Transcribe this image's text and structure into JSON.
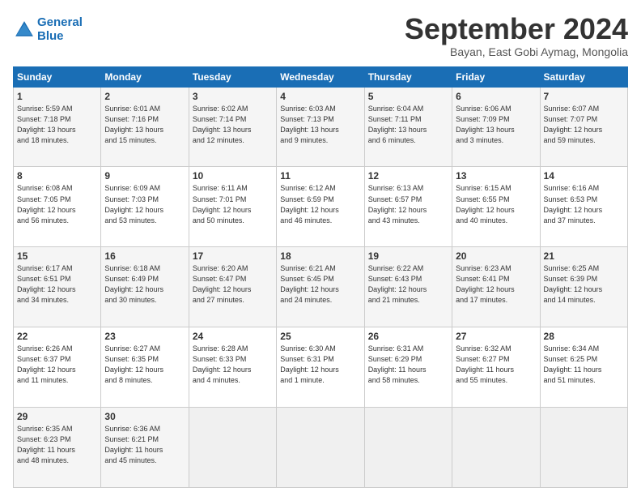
{
  "header": {
    "logo_line1": "General",
    "logo_line2": "Blue",
    "month_title": "September 2024",
    "subtitle": "Bayan, East Gobi Aymag, Mongolia"
  },
  "weekdays": [
    "Sunday",
    "Monday",
    "Tuesday",
    "Wednesday",
    "Thursday",
    "Friday",
    "Saturday"
  ],
  "weeks": [
    [
      {
        "day": "1",
        "info": "Sunrise: 5:59 AM\nSunset: 7:18 PM\nDaylight: 13 hours\nand 18 minutes."
      },
      {
        "day": "2",
        "info": "Sunrise: 6:01 AM\nSunset: 7:16 PM\nDaylight: 13 hours\nand 15 minutes."
      },
      {
        "day": "3",
        "info": "Sunrise: 6:02 AM\nSunset: 7:14 PM\nDaylight: 13 hours\nand 12 minutes."
      },
      {
        "day": "4",
        "info": "Sunrise: 6:03 AM\nSunset: 7:13 PM\nDaylight: 13 hours\nand 9 minutes."
      },
      {
        "day": "5",
        "info": "Sunrise: 6:04 AM\nSunset: 7:11 PM\nDaylight: 13 hours\nand 6 minutes."
      },
      {
        "day": "6",
        "info": "Sunrise: 6:06 AM\nSunset: 7:09 PM\nDaylight: 13 hours\nand 3 minutes."
      },
      {
        "day": "7",
        "info": "Sunrise: 6:07 AM\nSunset: 7:07 PM\nDaylight: 12 hours\nand 59 minutes."
      }
    ],
    [
      {
        "day": "8",
        "info": "Sunrise: 6:08 AM\nSunset: 7:05 PM\nDaylight: 12 hours\nand 56 minutes."
      },
      {
        "day": "9",
        "info": "Sunrise: 6:09 AM\nSunset: 7:03 PM\nDaylight: 12 hours\nand 53 minutes."
      },
      {
        "day": "10",
        "info": "Sunrise: 6:11 AM\nSunset: 7:01 PM\nDaylight: 12 hours\nand 50 minutes."
      },
      {
        "day": "11",
        "info": "Sunrise: 6:12 AM\nSunset: 6:59 PM\nDaylight: 12 hours\nand 46 minutes."
      },
      {
        "day": "12",
        "info": "Sunrise: 6:13 AM\nSunset: 6:57 PM\nDaylight: 12 hours\nand 43 minutes."
      },
      {
        "day": "13",
        "info": "Sunrise: 6:15 AM\nSunset: 6:55 PM\nDaylight: 12 hours\nand 40 minutes."
      },
      {
        "day": "14",
        "info": "Sunrise: 6:16 AM\nSunset: 6:53 PM\nDaylight: 12 hours\nand 37 minutes."
      }
    ],
    [
      {
        "day": "15",
        "info": "Sunrise: 6:17 AM\nSunset: 6:51 PM\nDaylight: 12 hours\nand 34 minutes."
      },
      {
        "day": "16",
        "info": "Sunrise: 6:18 AM\nSunset: 6:49 PM\nDaylight: 12 hours\nand 30 minutes."
      },
      {
        "day": "17",
        "info": "Sunrise: 6:20 AM\nSunset: 6:47 PM\nDaylight: 12 hours\nand 27 minutes."
      },
      {
        "day": "18",
        "info": "Sunrise: 6:21 AM\nSunset: 6:45 PM\nDaylight: 12 hours\nand 24 minutes."
      },
      {
        "day": "19",
        "info": "Sunrise: 6:22 AM\nSunset: 6:43 PM\nDaylight: 12 hours\nand 21 minutes."
      },
      {
        "day": "20",
        "info": "Sunrise: 6:23 AM\nSunset: 6:41 PM\nDaylight: 12 hours\nand 17 minutes."
      },
      {
        "day": "21",
        "info": "Sunrise: 6:25 AM\nSunset: 6:39 PM\nDaylight: 12 hours\nand 14 minutes."
      }
    ],
    [
      {
        "day": "22",
        "info": "Sunrise: 6:26 AM\nSunset: 6:37 PM\nDaylight: 12 hours\nand 11 minutes."
      },
      {
        "day": "23",
        "info": "Sunrise: 6:27 AM\nSunset: 6:35 PM\nDaylight: 12 hours\nand 8 minutes."
      },
      {
        "day": "24",
        "info": "Sunrise: 6:28 AM\nSunset: 6:33 PM\nDaylight: 12 hours\nand 4 minutes."
      },
      {
        "day": "25",
        "info": "Sunrise: 6:30 AM\nSunset: 6:31 PM\nDaylight: 12 hours\nand 1 minute."
      },
      {
        "day": "26",
        "info": "Sunrise: 6:31 AM\nSunset: 6:29 PM\nDaylight: 11 hours\nand 58 minutes."
      },
      {
        "day": "27",
        "info": "Sunrise: 6:32 AM\nSunset: 6:27 PM\nDaylight: 11 hours\nand 55 minutes."
      },
      {
        "day": "28",
        "info": "Sunrise: 6:34 AM\nSunset: 6:25 PM\nDaylight: 11 hours\nand 51 minutes."
      }
    ],
    [
      {
        "day": "29",
        "info": "Sunrise: 6:35 AM\nSunset: 6:23 PM\nDaylight: 11 hours\nand 48 minutes."
      },
      {
        "day": "30",
        "info": "Sunrise: 6:36 AM\nSunset: 6:21 PM\nDaylight: 11 hours\nand 45 minutes."
      },
      {
        "day": "",
        "info": ""
      },
      {
        "day": "",
        "info": ""
      },
      {
        "day": "",
        "info": ""
      },
      {
        "day": "",
        "info": ""
      },
      {
        "day": "",
        "info": ""
      }
    ]
  ]
}
